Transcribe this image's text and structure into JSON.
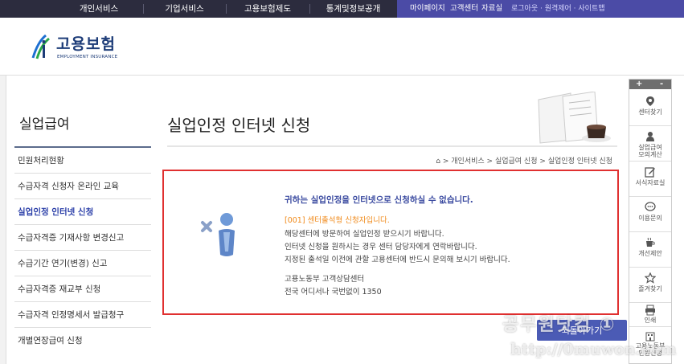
{
  "topnav": {
    "items": [
      "개인서비스",
      "기업서비스",
      "고용보험제도",
      "통계및정보공개"
    ],
    "right": [
      "마이페이지",
      "고객센터",
      "자료실"
    ],
    "util": "로그아웃 · 원격제어 · 사이트맵"
  },
  "logo": {
    "text": "고용보험",
    "sub": "EMPLOYMENT INSURANCE"
  },
  "sidebar": {
    "title": "실업급여",
    "items": [
      "민원처리현황",
      "수급자격 신청자 온라인 교육",
      "실업인정 인터넷 신청",
      "수급자격증 기재사항 변경신고",
      "수급기간 연기(변경) 신고",
      "수급자격증 재교부 신청",
      "수급자격 인정명세서 발급청구",
      "개별연장급여 신청"
    ]
  },
  "main": {
    "title": "실업인정 인터넷 신청",
    "breadcrumb": "> 개인서비스 > 실업급여 신청 > 실업인정 인터넷 신청"
  },
  "notice": {
    "heading": "귀하는 실업인정을 인터넷으로 신청하실 수 없습니다.",
    "code": "[001] 센터출석형 신청자입니다.",
    "lines": [
      "해당센터에 방문하여 실업인정 받으시기 바랍니다.",
      "인터넷 신청을 원하시는 경우 센터 담당자에게 연락바랍니다.",
      "지정된 출석일 이전에 관할 고용센터에 반드시 문의해 보시기 바랍니다."
    ],
    "contact_name": "고용노동부 고객상담센터",
    "contact_phone": "전국 어디서나 국번없이 1350"
  },
  "back_label": "되돌아가기",
  "quickbar": {
    "plus": "+",
    "minus": "-",
    "items": [
      {
        "label": "센터찾기",
        "icon": "map-pin-icon"
      },
      {
        "label": "실업급여\n모의계산",
        "icon": "person-icon"
      },
      {
        "label": "서식자료실",
        "icon": "edit-icon"
      },
      {
        "label": "이용문의",
        "icon": "chat-icon"
      },
      {
        "label": "개선제안",
        "icon": "cup-icon"
      },
      {
        "label": "즐겨찾기",
        "icon": "star-icon"
      },
      {
        "label": "인쇄",
        "icon": "print-icon"
      },
      {
        "label": "고용노동부\n민원신청",
        "icon": "building-icon"
      }
    ]
  },
  "watermark": {
    "line1": "공무원닷컴 ①",
    "line2": "http://0muwon.com"
  },
  "colors": {
    "nav_dark": "#2c2c3e",
    "nav_accent": "#4b4ba6",
    "alert_red": "#e03030",
    "warn_orange": "#f08a1a",
    "button": "#4b5bb5"
  }
}
